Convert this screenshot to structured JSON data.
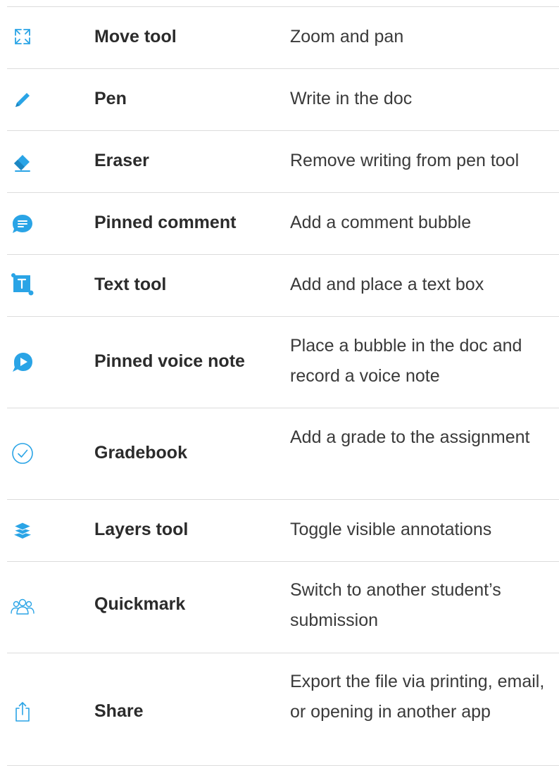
{
  "accent_color": "#2aa4e6",
  "tools": [
    {
      "icon": "expand-arrows-icon",
      "name": "Move tool",
      "description": "Zoom and pan"
    },
    {
      "icon": "pen-icon",
      "name": "Pen",
      "description": "Write in the doc"
    },
    {
      "icon": "eraser-icon",
      "name": "Eraser",
      "description": "Remove writing from pen tool"
    },
    {
      "icon": "comment-bubble-icon",
      "name": "Pinned comment",
      "description": "Add a comment bubble"
    },
    {
      "icon": "text-box-icon",
      "name": "Text tool",
      "description": "Add and place a text box"
    },
    {
      "icon": "voice-bubble-icon",
      "name": "Pinned voice note",
      "description": "Place a bubble in the doc and record a voice note"
    },
    {
      "icon": "check-circle-icon",
      "name": "Gradebook",
      "description": "Add a grade to the assignment"
    },
    {
      "icon": "layers-icon",
      "name": "Layers tool",
      "description": "Toggle visible annotations"
    },
    {
      "icon": "users-group-icon",
      "name": "Quickmark",
      "description": "Switch to another student’s submission"
    },
    {
      "icon": "share-icon",
      "name": "Share",
      "description": "Export the file via printing, email, or opening in another app"
    }
  ]
}
